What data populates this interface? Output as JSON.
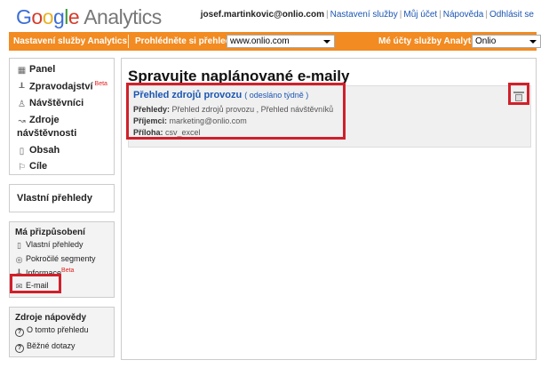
{
  "header": {
    "logo_letters": [
      "G",
      "o",
      "o",
      "g",
      "l",
      "e"
    ],
    "logo_product": "Analytics",
    "user_email": "josef.martinkovic@onlio.com",
    "links": [
      "Nastavení služby",
      "Můj účet",
      "Nápověda",
      "Odhlásit se"
    ]
  },
  "topbar": {
    "settings_label": "Nastavení služby Analytics",
    "browse_label": "Prohlédněte si přehledy:",
    "browse_value": "www.onlio.com",
    "accounts_label": "Mé účty služby Analytics:",
    "accounts_value": "Onlio"
  },
  "sidebar": {
    "nav": [
      {
        "label": "Panel",
        "icon": "dashboard-icon"
      },
      {
        "label": "Zpravodajství",
        "icon": "bar-chart-icon",
        "badge": "Beta"
      },
      {
        "label": "Návštěvníci",
        "icon": "visitor-icon"
      },
      {
        "label_line1": "Zdroje",
        "label_line2": "návštěvnosti",
        "icon": "traffic-sources-icon"
      },
      {
        "label": "Obsah",
        "icon": "content-icon"
      },
      {
        "label": "Cíle",
        "icon": "flag-icon"
      }
    ],
    "custom_reports": "Vlastní přehledy",
    "customize": {
      "title": "Má přizpůsobení",
      "items": [
        {
          "label": "Vlastní přehledy",
          "icon": "report-icon"
        },
        {
          "label": "Pokročilé segmenty",
          "icon": "segment-icon"
        },
        {
          "label": "Informace",
          "icon": "chart-icon",
          "badge": "Beta"
        },
        {
          "label": "E-mail",
          "icon": "mail-icon"
        }
      ]
    },
    "help": {
      "title": "Zdroje nápovědy",
      "items": [
        "O tomto přehledu",
        "Běžné dotazy"
      ]
    }
  },
  "main": {
    "title": "Spravujte naplánované e-maily",
    "report": {
      "title": "Přehled zdrojů provozu",
      "frequency": "( odesláno týdně )",
      "reports_label": "Přehledy:",
      "reports_value": "Přehled zdrojů provozu , Přehled návštěvníků",
      "recipients_label": "Příjemci:",
      "recipients_value": "marketing@onlio.com",
      "attachment_label": "Příloha:",
      "attachment_value": "csv_excel"
    }
  },
  "colors": {
    "orange_bar": "#f28b21",
    "highlight_red": "#d0202a",
    "link_blue": "#1b56b3"
  }
}
